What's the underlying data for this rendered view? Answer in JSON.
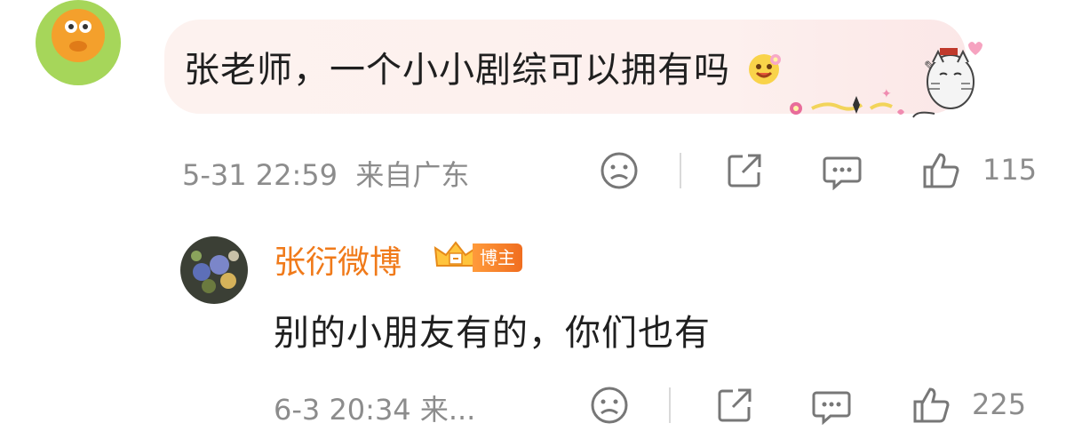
{
  "comment": {
    "author_cutoff": "",
    "text": "张老师，一个小小剧综可以拥有吗",
    "time": "5-31 22:59",
    "location": "来自广东",
    "likes": "115"
  },
  "reply": {
    "author": "张衍微博",
    "badge": "博主",
    "text": "别的小朋友有的，你们也有",
    "meta": "6-3 20:34  来...",
    "likes": "225"
  },
  "colors": {
    "author_orange": "#f07a1a",
    "meta_gray": "#8c8c8c",
    "bubble_pink": "#fdf0ee"
  },
  "icons": [
    "sad-face-icon",
    "share-icon",
    "comment-icon",
    "thumbs-up-icon"
  ]
}
